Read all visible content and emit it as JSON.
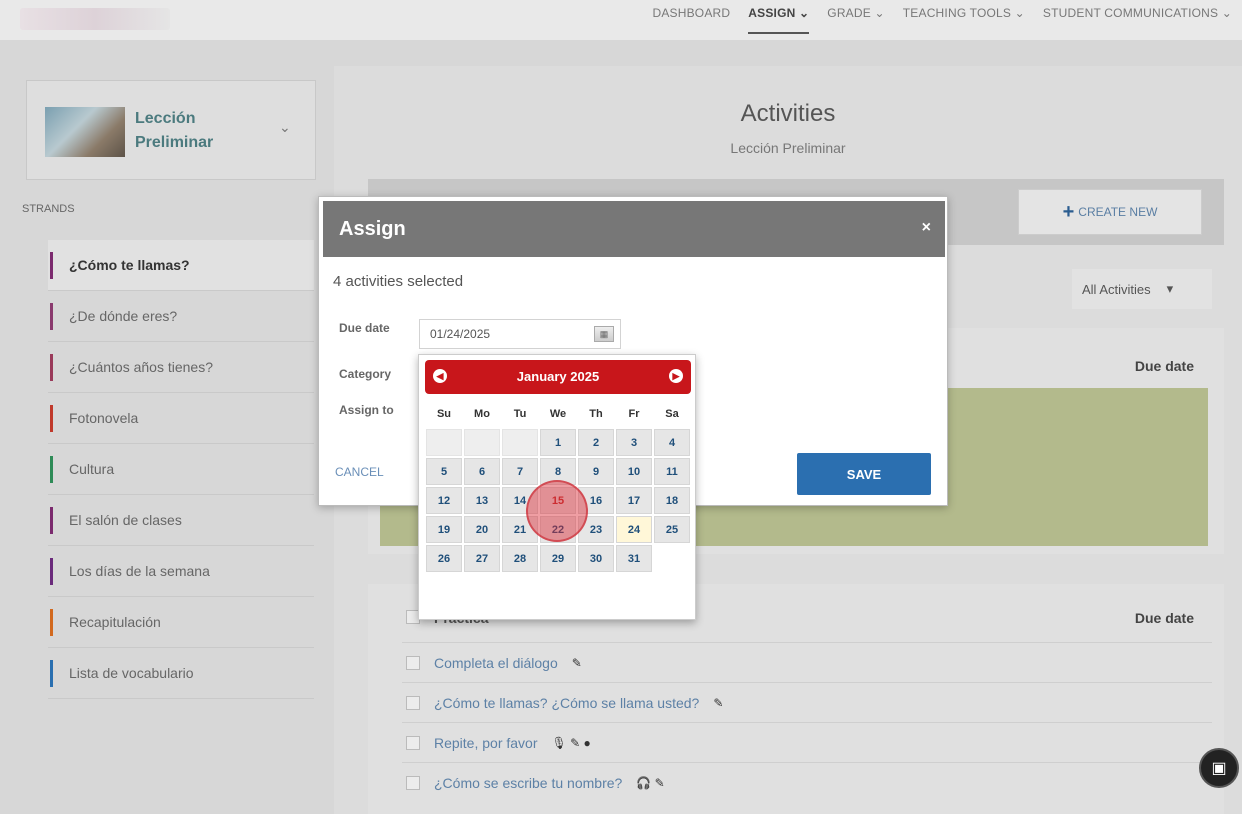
{
  "nav": {
    "items": [
      "DASHBOARD",
      "ASSIGN ⌄",
      "GRADE ⌄",
      "TEACHING TOOLS ⌄",
      "STUDENT COMMUNICATIONS ⌄"
    ]
  },
  "sidebar": {
    "lesson_title": "Lección Preliminar",
    "strands_label": "STRANDS",
    "strands": [
      {
        "label": "¿Cómo te llamas?",
        "color": "#7b2a6e",
        "active": true
      },
      {
        "label": "¿De dónde eres?",
        "color": "#8a3a6e"
      },
      {
        "label": "¿Cuántos años tienes?",
        "color": "#9a3a5a"
      },
      {
        "label": "Fotonovela",
        "color": "#c0392b"
      },
      {
        "label": "Cultura",
        "color": "#2e8b57"
      },
      {
        "label": "El salón de clases",
        "color": "#7b2a6e"
      },
      {
        "label": "Los días de la semana",
        "color": "#6a2a7b"
      },
      {
        "label": "Recapitulación",
        "color": "#d2691e"
      },
      {
        "label": "Lista de vocabulario",
        "color": "#2a6fb0"
      }
    ]
  },
  "main": {
    "title": "Activities",
    "subtitle": "Lección Preliminar",
    "create_new": "CREATE NEW",
    "filter": "All Activities",
    "due_date_header": "Due date",
    "section2": {
      "name": "Práctica",
      "due_date_header": "Due date",
      "rows": [
        {
          "text": "Completa el diálogo",
          "icons": "✎"
        },
        {
          "text": "¿Cómo te llamas? ¿Cómo se llama usted?",
          "icons": "✎"
        },
        {
          "text": "Repite, por favor",
          "icons": "🎙 ✎ ●"
        },
        {
          "text": "¿Cómo se escribe tu nombre?",
          "icons": "🎧 ✎"
        }
      ]
    }
  },
  "modal": {
    "title": "Assign",
    "close": "×",
    "selected_text": "4 activities selected",
    "due_date_label": "Due date",
    "due_date_value": "01/24/2025",
    "category_label": "Category",
    "assign_to_label": "Assign to",
    "cancel": "CANCEL",
    "save": "SAVE"
  },
  "datepicker": {
    "title": "January 2025",
    "prev": "◀",
    "next": "▶",
    "weekdays": [
      "Su",
      "Mo",
      "Tu",
      "We",
      "Th",
      "Fr",
      "Sa"
    ],
    "leading_blanks": 3,
    "days": 31,
    "today": 24,
    "hovered": 15
  },
  "colors": {
    "datepicker_header": "#c8161b",
    "save_button": "#2b6fb0",
    "link": "#5d81a6"
  }
}
